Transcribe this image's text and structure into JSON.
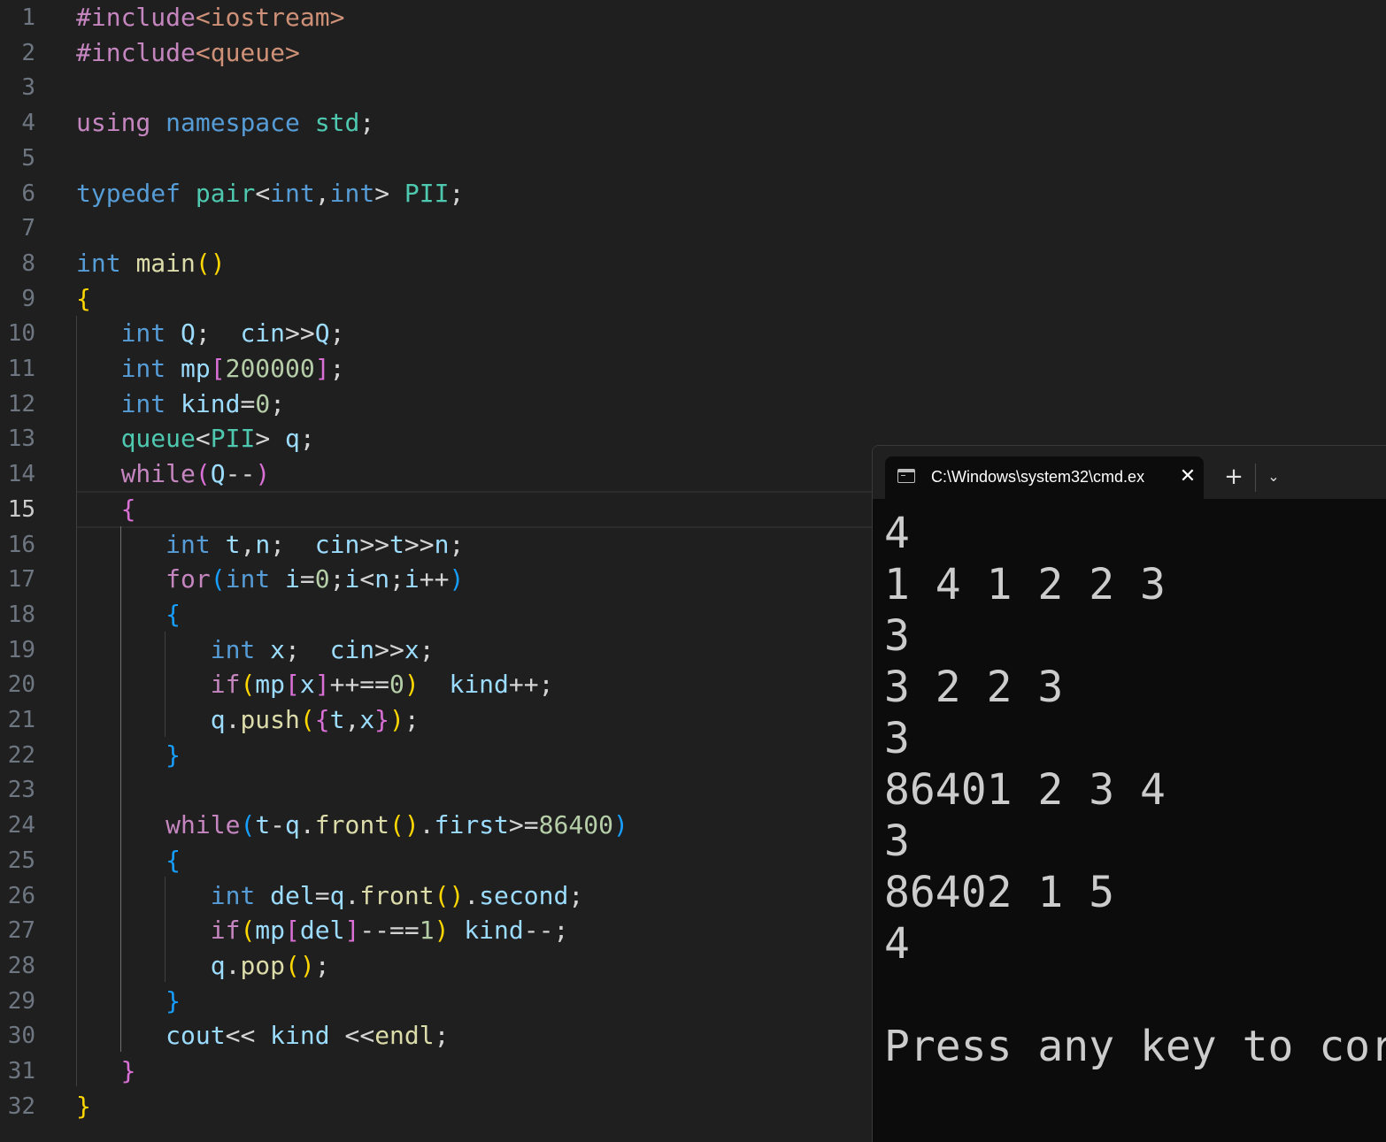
{
  "editor": {
    "active_line": 15,
    "lines": [
      [
        [
          "t-pre",
          "#include"
        ],
        [
          "t-str",
          "<iostream>"
        ]
      ],
      [
        [
          "t-pre",
          "#include"
        ],
        [
          "t-str",
          "<queue>"
        ]
      ],
      [],
      [
        [
          "t-ctrl",
          "using"
        ],
        [
          "",
          " "
        ],
        [
          "t-key",
          "namespace"
        ],
        [
          "",
          " "
        ],
        [
          "t-type",
          "std"
        ],
        [
          "t-op",
          ";"
        ]
      ],
      [],
      [
        [
          "t-key",
          "typedef"
        ],
        [
          "",
          " "
        ],
        [
          "t-type",
          "pair"
        ],
        [
          "t-op",
          "<"
        ],
        [
          "t-key",
          "int"
        ],
        [
          "t-op",
          ","
        ],
        [
          "t-key",
          "int"
        ],
        [
          "t-op",
          ">"
        ],
        [
          "",
          " "
        ],
        [
          "t-type",
          "PII"
        ],
        [
          "t-op",
          ";"
        ]
      ],
      [],
      [
        [
          "t-key",
          "int"
        ],
        [
          "",
          " "
        ],
        [
          "t-fn",
          "main"
        ],
        [
          "b1",
          "()"
        ]
      ],
      [
        [
          "b1",
          "{"
        ]
      ],
      [
        [
          "",
          "   "
        ],
        [
          "t-key",
          "int"
        ],
        [
          "",
          " "
        ],
        [
          "t-var",
          "Q"
        ],
        [
          "t-op",
          ";"
        ],
        [
          "",
          "  "
        ],
        [
          "t-var",
          "cin"
        ],
        [
          "t-op",
          ">>"
        ],
        [
          "t-var",
          "Q"
        ],
        [
          "t-op",
          ";"
        ]
      ],
      [
        [
          "",
          "   "
        ],
        [
          "t-key",
          "int"
        ],
        [
          "",
          " "
        ],
        [
          "t-var",
          "mp"
        ],
        [
          "b2",
          "["
        ],
        [
          "t-num",
          "200000"
        ],
        [
          "b2",
          "]"
        ],
        [
          "t-op",
          ";"
        ]
      ],
      [
        [
          "",
          "   "
        ],
        [
          "t-key",
          "int"
        ],
        [
          "",
          " "
        ],
        [
          "t-var",
          "kind"
        ],
        [
          "t-op",
          "="
        ],
        [
          "t-num",
          "0"
        ],
        [
          "t-op",
          ";"
        ]
      ],
      [
        [
          "",
          "   "
        ],
        [
          "t-type",
          "queue"
        ],
        [
          "t-op",
          "<"
        ],
        [
          "t-type",
          "PII"
        ],
        [
          "t-op",
          ">"
        ],
        [
          "",
          " "
        ],
        [
          "t-var",
          "q"
        ],
        [
          "t-op",
          ";"
        ]
      ],
      [
        [
          "",
          "   "
        ],
        [
          "t-ctrl",
          "while"
        ],
        [
          "b2",
          "("
        ],
        [
          "t-var",
          "Q"
        ],
        [
          "t-op",
          "--"
        ],
        [
          "b2",
          ")"
        ]
      ],
      [
        [
          "",
          "   "
        ],
        [
          "b2",
          "{"
        ]
      ],
      [
        [
          "",
          "      "
        ],
        [
          "t-key",
          "int"
        ],
        [
          "",
          " "
        ],
        [
          "t-var",
          "t"
        ],
        [
          "t-op",
          ","
        ],
        [
          "t-var",
          "n"
        ],
        [
          "t-op",
          ";"
        ],
        [
          "",
          "  "
        ],
        [
          "t-var",
          "cin"
        ],
        [
          "t-op",
          ">>"
        ],
        [
          "t-var",
          "t"
        ],
        [
          "t-op",
          ">>"
        ],
        [
          "t-var",
          "n"
        ],
        [
          "t-op",
          ";"
        ]
      ],
      [
        [
          "",
          "      "
        ],
        [
          "t-ctrl",
          "for"
        ],
        [
          "b3",
          "("
        ],
        [
          "t-key",
          "int"
        ],
        [
          "",
          " "
        ],
        [
          "t-var",
          "i"
        ],
        [
          "t-op",
          "="
        ],
        [
          "t-num",
          "0"
        ],
        [
          "t-op",
          ";"
        ],
        [
          "t-var",
          "i"
        ],
        [
          "t-op",
          "<"
        ],
        [
          "t-var",
          "n"
        ],
        [
          "t-op",
          ";"
        ],
        [
          "t-var",
          "i"
        ],
        [
          "t-op",
          "++"
        ],
        [
          "b3",
          ")"
        ]
      ],
      [
        [
          "",
          "      "
        ],
        [
          "b3",
          "{"
        ]
      ],
      [
        [
          "",
          "         "
        ],
        [
          "t-key",
          "int"
        ],
        [
          "",
          " "
        ],
        [
          "t-var",
          "x"
        ],
        [
          "t-op",
          ";"
        ],
        [
          "",
          "  "
        ],
        [
          "t-var",
          "cin"
        ],
        [
          "t-op",
          ">>"
        ],
        [
          "t-var",
          "x"
        ],
        [
          "t-op",
          ";"
        ]
      ],
      [
        [
          "",
          "         "
        ],
        [
          "t-ctrl",
          "if"
        ],
        [
          "b1",
          "("
        ],
        [
          "t-var",
          "mp"
        ],
        [
          "b2",
          "["
        ],
        [
          "t-var",
          "x"
        ],
        [
          "b2",
          "]"
        ],
        [
          "t-op",
          "++=="
        ],
        [
          "t-num",
          "0"
        ],
        [
          "b1",
          ")"
        ],
        [
          "",
          "  "
        ],
        [
          "t-var",
          "kind"
        ],
        [
          "t-op",
          "++;"
        ]
      ],
      [
        [
          "",
          "         "
        ],
        [
          "t-var",
          "q"
        ],
        [
          "t-op",
          "."
        ],
        [
          "t-fn",
          "push"
        ],
        [
          "b1",
          "("
        ],
        [
          "b2",
          "{"
        ],
        [
          "t-var",
          "t"
        ],
        [
          "t-op",
          ","
        ],
        [
          "t-var",
          "x"
        ],
        [
          "b2",
          "}"
        ],
        [
          "b1",
          ")"
        ],
        [
          "t-op",
          ";"
        ]
      ],
      [
        [
          "",
          "      "
        ],
        [
          "b3",
          "}"
        ]
      ],
      [],
      [
        [
          "",
          "      "
        ],
        [
          "t-ctrl",
          "while"
        ],
        [
          "b3",
          "("
        ],
        [
          "t-var",
          "t"
        ],
        [
          "t-op",
          "-"
        ],
        [
          "t-var",
          "q"
        ],
        [
          "t-op",
          "."
        ],
        [
          "t-fn",
          "front"
        ],
        [
          "b1",
          "()"
        ],
        [
          "t-op",
          "."
        ],
        [
          "t-var",
          "first"
        ],
        [
          "t-op",
          ">="
        ],
        [
          "t-num",
          "86400"
        ],
        [
          "b3",
          ")"
        ]
      ],
      [
        [
          "",
          "      "
        ],
        [
          "b3",
          "{"
        ]
      ],
      [
        [
          "",
          "         "
        ],
        [
          "t-key",
          "int"
        ],
        [
          "",
          " "
        ],
        [
          "t-var",
          "del"
        ],
        [
          "t-op",
          "="
        ],
        [
          "t-var",
          "q"
        ],
        [
          "t-op",
          "."
        ],
        [
          "t-fn",
          "front"
        ],
        [
          "b1",
          "()"
        ],
        [
          "t-op",
          "."
        ],
        [
          "t-var",
          "second"
        ],
        [
          "t-op",
          ";"
        ]
      ],
      [
        [
          "",
          "         "
        ],
        [
          "t-ctrl",
          "if"
        ],
        [
          "b1",
          "("
        ],
        [
          "t-var",
          "mp"
        ],
        [
          "b2",
          "["
        ],
        [
          "t-var",
          "del"
        ],
        [
          "b2",
          "]"
        ],
        [
          "t-op",
          "--=="
        ],
        [
          "t-num",
          "1"
        ],
        [
          "b1",
          ")"
        ],
        [
          "",
          " "
        ],
        [
          "t-var",
          "kind"
        ],
        [
          "t-op",
          "--;"
        ]
      ],
      [
        [
          "",
          "         "
        ],
        [
          "t-var",
          "q"
        ],
        [
          "t-op",
          "."
        ],
        [
          "t-fn",
          "pop"
        ],
        [
          "b1",
          "()"
        ],
        [
          "t-op",
          ";"
        ]
      ],
      [
        [
          "",
          "      "
        ],
        [
          "b3",
          "}"
        ]
      ],
      [
        [
          "",
          "      "
        ],
        [
          "t-var",
          "cout"
        ],
        [
          "t-op",
          "<<"
        ],
        [
          "",
          " "
        ],
        [
          "t-var",
          "kind"
        ],
        [
          "",
          " "
        ],
        [
          "t-op",
          "<<"
        ],
        [
          "t-fn",
          "endl"
        ],
        [
          "t-op",
          ";"
        ]
      ],
      [
        [
          "",
          "   "
        ],
        [
          "b2",
          "}"
        ]
      ],
      [
        [
          "b1",
          "}"
        ]
      ]
    ]
  },
  "terminal": {
    "tab_title": "C:\\Windows\\system32\\cmd.ex",
    "tab_icon": "terminal-icon",
    "close_glyph": "✕",
    "new_tab_glyph": "+",
    "dropdown_glyph": "⌄",
    "output": [
      "4",
      "1 4 1 2 2 3",
      "3",
      "3 2 2 3",
      "3",
      "86401 2 3 4",
      "3",
      "86402 1 5",
      "4",
      "",
      "Press any key to cor"
    ]
  }
}
